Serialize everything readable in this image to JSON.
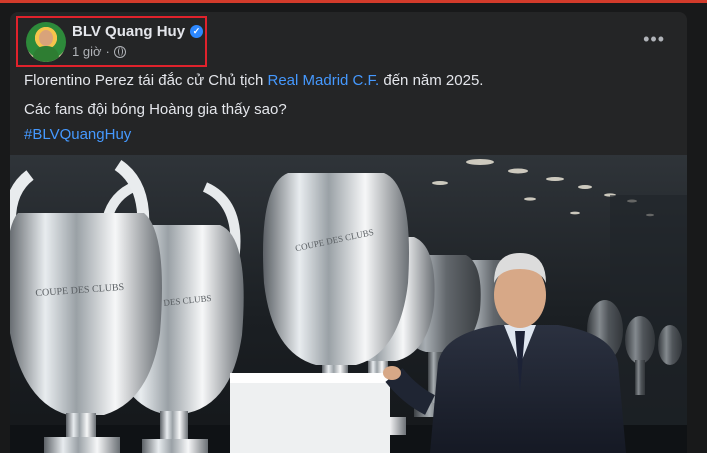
{
  "post": {
    "author": "BLV Quang Huy",
    "time": "1 giờ",
    "separator": "·",
    "more_label": "•••",
    "verified_mark": "✓",
    "line1_before": "Florentino Perez tái đắc cử Chủ tịch ",
    "line1_link": "Real Madrid C.F.",
    "line1_after": " đến năm 2025.",
    "line2": "Các fans đội bóng Hoàng gia thấy sao?",
    "hashtag": "#BLVQuangHuy"
  },
  "icons": {
    "avatar": "profile-avatar",
    "verified": "verified-badge-icon",
    "privacy": "globe-icon",
    "more": "more-options-icon"
  },
  "colors": {
    "background": "#18191a",
    "card": "#242526",
    "text": "#e4e6eb",
    "secondary_text": "#b0b3b8",
    "link": "#4599ff",
    "highlight_box": "#e0222c",
    "verified": "#2d88ff"
  }
}
